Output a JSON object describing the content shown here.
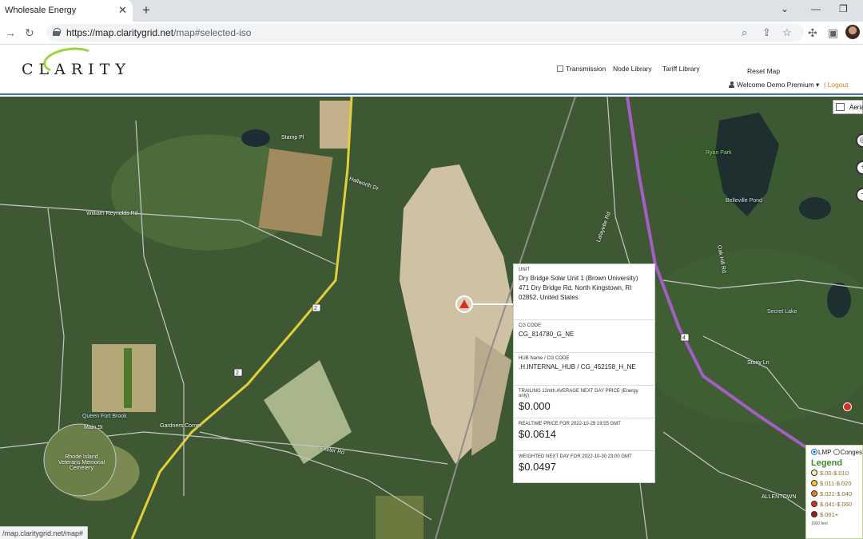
{
  "browser": {
    "tab_title": "Wholesale Energy",
    "tab_close": "✕",
    "new_tab": "+",
    "url_domain": "https://map.claritygrid.net",
    "url_path": "/map#selected-iso",
    "status_url": "/map.claritygrid.net/map#"
  },
  "header": {
    "logo": "CLARITY",
    "transmission_label": "Transmission",
    "node_library": "Node Library",
    "tariff_library": "Tariff Library",
    "reset_map": "Reset Map",
    "welcome": "Welcome Demo Premium",
    "logout": "Logout"
  },
  "map": {
    "aerial_label": "Aeria",
    "labels": [
      "William Reynolds Rd",
      "Ryan Park",
      "Belleville Pond",
      "Secret Lake",
      "Lafayette Rd",
      "Queen Fort Brook",
      "Gardners Corner",
      "Main St",
      "Exeter Rd",
      "Rhode Island Veterans Memorial Cemetery",
      "ALLENTOWN",
      "Stamp Pl",
      "Hallworth Dr",
      "Oak Hill Rd",
      "Stony Ln"
    ],
    "route_shields": [
      "2",
      "2",
      "4"
    ]
  },
  "popup": {
    "unit_label": "UNIT",
    "unit_name": "Dry Bridge Solar Unit 1 (Brown University)",
    "unit_address_1": "471 Dry Bridge Rd, North Kingstown, RI",
    "unit_address_2": "02852, United States",
    "cg_code_label": "CG CODE",
    "cg_code": "CG_814780_G_NE",
    "hub_label": "HUB Name / CG CODE",
    "hub_value": ".H.INTERNAL_HUB / CG_452158_H_NE",
    "trailing_label": "TRAILING 12mth AVERAGE NEXT DAY PRICE (Energy only)",
    "trailing_value": "$0.000",
    "realtime_label": "REALTIME PRICE FOR 2022-10-29 19:55 GMT",
    "realtime_value": "$0.0614",
    "weighted_label": "WEIGHTED NEXT DAY FOR 2022-10-30 23:00 GMT",
    "weighted_value": "$0.0497"
  },
  "legend": {
    "option_lmp": "LMP",
    "option_cong": "Conges",
    "title": "Legend",
    "rows": [
      {
        "label": "$.00-$.010",
        "color": "#f3f0a8"
      },
      {
        "label": "$.011-$.020",
        "color": "#f2c230"
      },
      {
        "label": "$.021-$.040",
        "color": "#ea7d1e"
      },
      {
        "label": "$.041-$.060",
        "color": "#d9301c"
      },
      {
        "label": "$.061+",
        "color": "#a11a12"
      }
    ],
    "scale": "1000 feet"
  },
  "colors": {
    "accent_blue": "#3a78c2",
    "logout_orange": "#e07a16",
    "legend_green": "#3b8c2a",
    "marker_red": "#d93025"
  }
}
